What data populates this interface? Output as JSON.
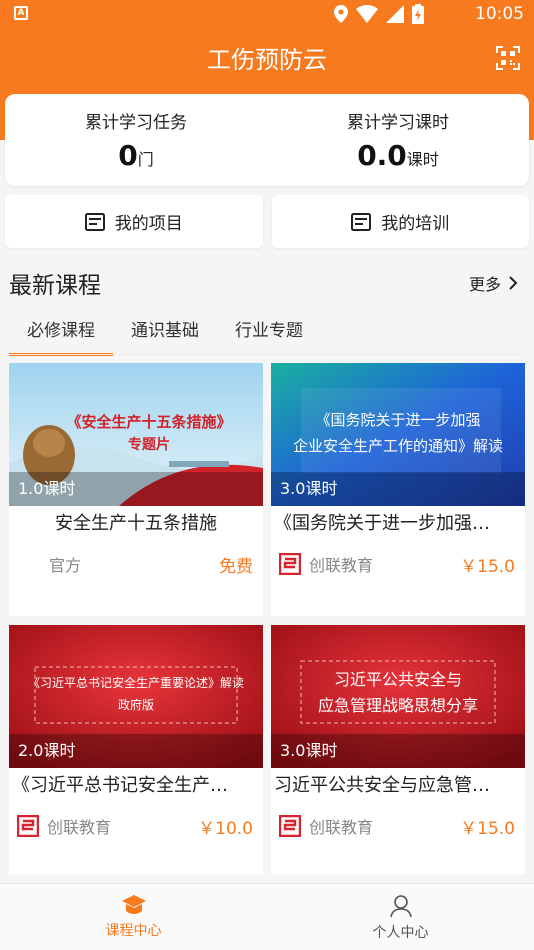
{
  "status_bar": {
    "time": "10:05",
    "notification_letter": "A"
  },
  "header": {
    "title": "工伤预防云"
  },
  "stats": [
    {
      "label": "累计学习任务",
      "value": "0",
      "unit": "门"
    },
    {
      "label": "累计学习课时",
      "value": "0.0",
      "unit": "课时"
    }
  ],
  "quick_actions": [
    {
      "label": "我的项目"
    },
    {
      "label": "我的培训"
    }
  ],
  "section": {
    "title": "最新课程",
    "more": "更多"
  },
  "tabs": [
    {
      "label": "必修课程",
      "active": true
    },
    {
      "label": "通识基础",
      "active": false
    },
    {
      "label": "行业专题",
      "active": false
    }
  ],
  "courses": [
    {
      "thumb_line1": "《安全生产十五条措施》",
      "thumb_line2": "专题片",
      "hours": "1.0课时",
      "title": "安全生产十五条措施",
      "provider": "官方",
      "price": "免费"
    },
    {
      "thumb_line1": "《国务院关于进一步加强",
      "thumb_line2": "企业安全生产工作的通知》解读",
      "hours": "3.0课时",
      "title": "《国务院关于进一步加强…",
      "provider": "创联教育",
      "price": "￥15.0"
    },
    {
      "thumb_line1": "《习近平总书记安全生产重要论述》解读",
      "thumb_line2": "政府版",
      "hours": "2.0课时",
      "title": "《习近平总书记安全生产…",
      "provider": "创联教育",
      "price": "￥10.0"
    },
    {
      "thumb_line1": "习近平公共安全与",
      "thumb_line2": "应急管理战略思想分享",
      "hours": "3.0课时",
      "title": "习近平公共安全与应急管…",
      "provider": "创联教育",
      "price": "￥15.0"
    }
  ],
  "bottom_nav": [
    {
      "label": "课程中心",
      "active": true
    },
    {
      "label": "个人中心",
      "active": false
    }
  ],
  "colors": {
    "accent": "#f87a1e",
    "brand_red": "#d7252f"
  }
}
